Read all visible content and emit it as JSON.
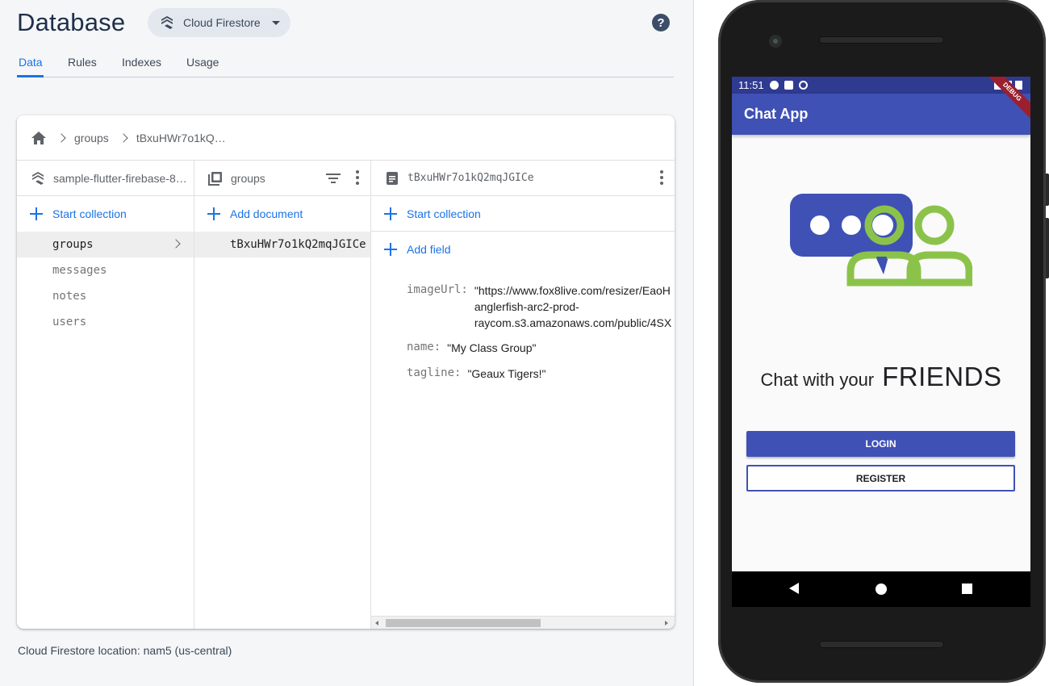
{
  "console": {
    "title": "Database",
    "db_selector": {
      "label": "Cloud Firestore",
      "icon": "firestore-icon"
    },
    "help_icon_glyph": "?",
    "tabs": [
      {
        "label": "Data",
        "active": true
      },
      {
        "label": "Rules",
        "active": false
      },
      {
        "label": "Indexes",
        "active": false
      },
      {
        "label": "Usage",
        "active": false
      }
    ],
    "breadcrumb": [
      "groups",
      "tBxuHWr7o1kQ…"
    ],
    "columns": {
      "root": {
        "header": "sample-flutter-firebase-8…",
        "action": "Start collection",
        "items": [
          {
            "label": "groups",
            "selected": true
          },
          {
            "label": "messages",
            "selected": false
          },
          {
            "label": "notes",
            "selected": false
          },
          {
            "label": "users",
            "selected": false
          }
        ]
      },
      "collection": {
        "header": "groups",
        "action": "Add document",
        "items": [
          "tBxuHWr7o1kQ2mqJGICe"
        ]
      },
      "document": {
        "header": "tBxuHWr7o1kQ2mqJGICe",
        "action_collection": "Start collection",
        "action_field": "Add field",
        "fields": [
          {
            "key": "imageUrl:",
            "value_lines": [
              "\"https://www.fox8live.com/resizer/EaoH",
              "anglerfish-arc2-prod-",
              "raycom.s3.amazonaws.com/public/4SX"
            ]
          },
          {
            "key": "name:",
            "value_lines": [
              "\"My Class Group\""
            ]
          },
          {
            "key": "tagline:",
            "value_lines": [
              "\"Geaux Tigers!\""
            ]
          }
        ]
      }
    },
    "location": "Cloud Firestore location: nam5 (us-central)"
  },
  "phone": {
    "status_time": "11:51",
    "debug_banner": "DEBUG",
    "app_title": "Chat App",
    "headline_small": "Chat with your",
    "headline_big": "FRIENDS",
    "login_label": "LOGIN",
    "register_label": "REGISTER",
    "colors": {
      "primary": "#3f51b5",
      "status": "#2f3a91",
      "logo_green": "#8bc34a",
      "logo_blue": "#3f51b5"
    }
  }
}
